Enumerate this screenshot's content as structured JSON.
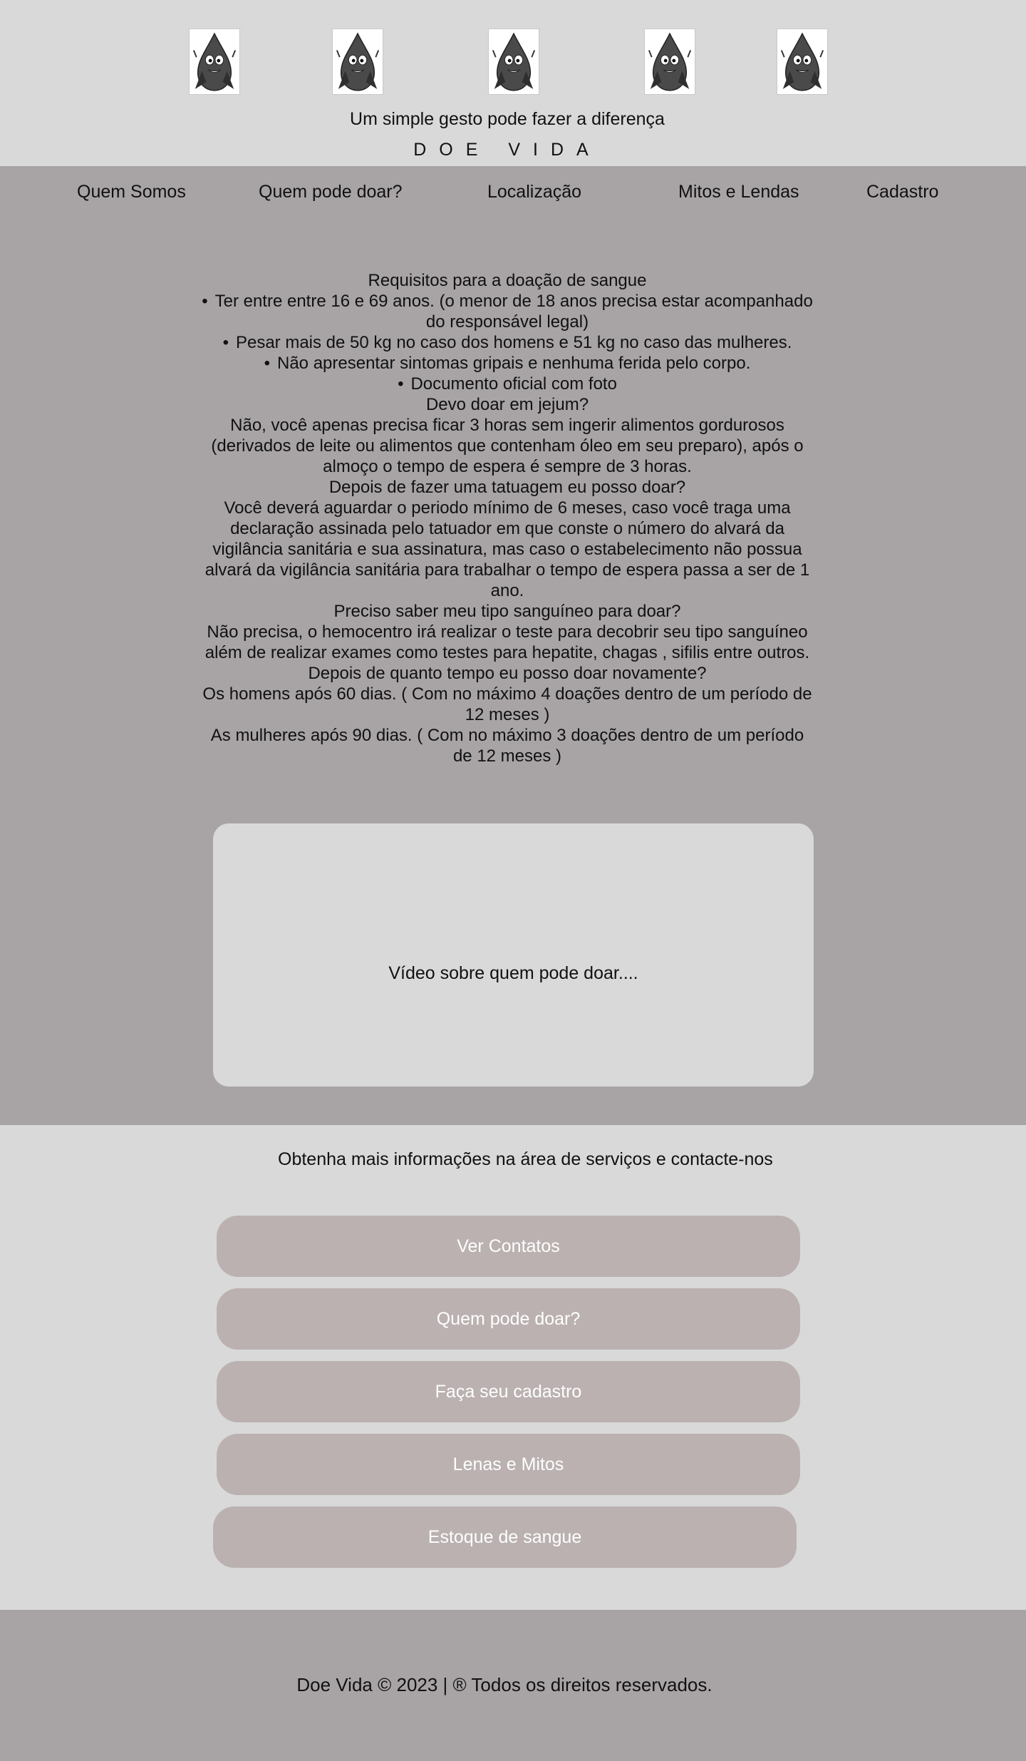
{
  "header": {
    "slogan": "Um simple gesto pode fazer a diferença",
    "brand": "DOE   VIDA",
    "mascot_icon": "blood-drop-mascot-icon"
  },
  "nav": {
    "items": [
      {
        "label": "Quem Somos"
      },
      {
        "label": "Quem pode doar?"
      },
      {
        "label": "Localização"
      },
      {
        "label": "Mitos e Lendas"
      },
      {
        "label": "Cadastro"
      }
    ]
  },
  "content": {
    "requirements_title": "Requisitos para a doação de sangue",
    "requirements": [
      "Ter entre entre 16 e 69 anos. (o menor de 18 anos precisa estar acompanhado do responsável legal)",
      "Pesar mais de 50 kg no caso dos homens e 51 kg no caso das mulheres.",
      "Não apresentar sintomas gripais e nenhuma ferida pelo corpo.",
      "Documento oficial com foto"
    ],
    "faq": [
      {
        "question": "Devo doar em jejum?",
        "answer": "Não, você apenas precisa ficar 3 horas sem ingerir alimentos gordurosos (derivados de leite ou alimentos que contenham óleo em seu preparo), após o almoço o tempo de espera é sempre de 3 horas."
      },
      {
        "question": "Depois de fazer uma tatuagem eu posso doar?",
        "answer": "Você deverá aguardar o periodo mínimo de 6 meses, caso você traga uma declaração assinada pelo tatuador em que conste o número do alvará da vigilância sanitária e sua assinatura, mas caso o estabelecimento não possua alvará da vigilância sanitária para trabalhar o tempo de espera passa a ser de 1 ano."
      },
      {
        "question": "Preciso saber meu tipo sanguíneo para doar?",
        "answer": "Não precisa, o hemocentro irá realizar o teste para decobrir seu tipo sanguíneo além de realizar exames como testes para hepatite, chagas , sifilis entre outros."
      }
    ],
    "interval_question": "Depois de quanto tempo eu posso doar novamente?",
    "interval_men": "Os homens após 60 dias. ( Com no máximo 4 doações dentro de um período de 12 meses )",
    "interval_women": "As mulheres após 90 dias. ( Com no máximo 3 doações dentro de um período de 12 meses )",
    "video_label": "Vídeo sobre quem pode doar...."
  },
  "services": {
    "title": "Obtenha mais informações na área de serviços e contacte-nos",
    "buttons": [
      {
        "label": "Ver Contatos"
      },
      {
        "label": "Quem pode doar?"
      },
      {
        "label": "Faça seu cadastro"
      },
      {
        "label": "Lenas e Mitos"
      },
      {
        "label": "Estoque de sangue"
      }
    ]
  },
  "footer": {
    "text": "Doe Vida © 2023 | ® Todos os direitos reservados."
  },
  "colors": {
    "header_bg": "#d9d9d9",
    "main_bg": "#a8a4a5",
    "button_bg": "#bbb1b1",
    "button_text": "#ffffff"
  }
}
